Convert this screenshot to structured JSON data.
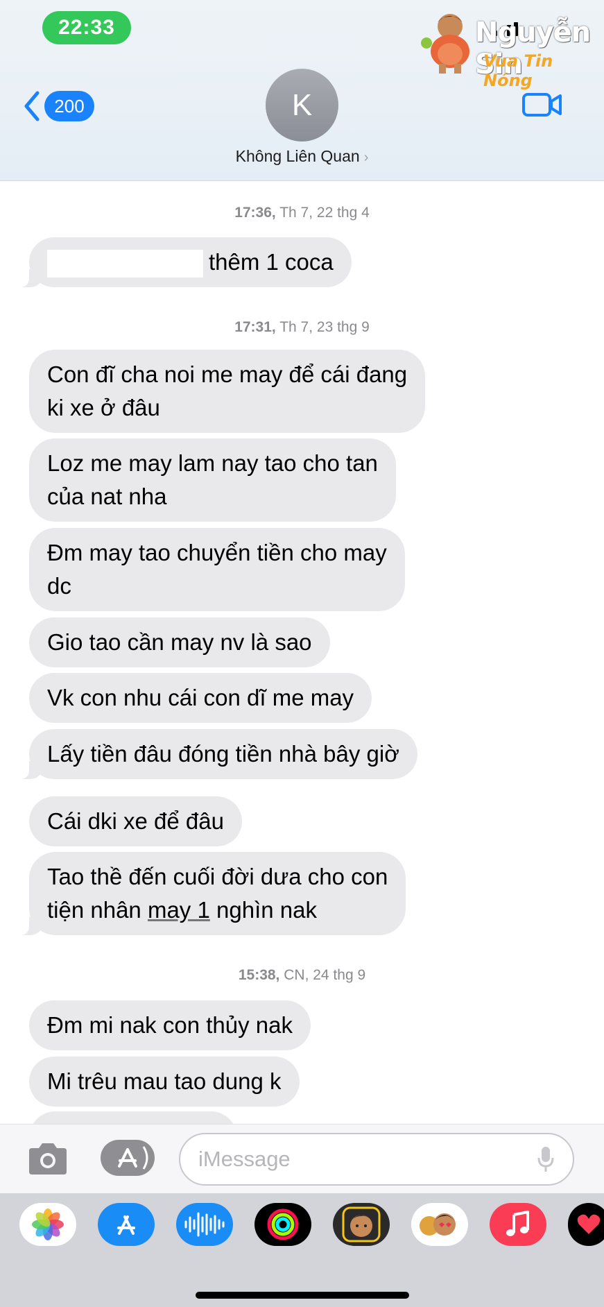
{
  "status_bar": {
    "time": "22:33"
  },
  "watermark": {
    "name": "Nguyễn Sin",
    "tagline": "Vua Tin Nóng"
  },
  "header": {
    "back_count": "200",
    "contact_initial": "K",
    "contact_name": "Không Liên Quan",
    "chevron": "›"
  },
  "messages": {
    "timestamps": [
      {
        "time": "17:36,",
        "date": "Th 7, 22 thg 4"
      },
      {
        "time": "17:31,",
        "date": "Th 7, 23 thg 9"
      },
      {
        "time": "15:38,",
        "date": "CN, 24 thg 9"
      }
    ],
    "bubbles": [
      {
        "text": "thêm 1 coca"
      },
      {
        "line1": "Con đĩ cha noi me may để cái đang",
        "line2": "ki xe ở đâu"
      },
      {
        "line1": "Loz me may lam nay tao cho tan",
        "line2": "của nat nha"
      },
      {
        "line1": "Đm may tao chuyển tiền cho may",
        "line2": "dc"
      },
      {
        "text": "Gio tao cần may nv là sao"
      },
      {
        "text": "Vk con nhu cái con dĩ me may"
      },
      {
        "text": "Lấy tiền đâu đóng tiền nhà bây giờ"
      },
      {
        "text": "Cái dki xe để đâu"
      },
      {
        "line1": "Tao thề đến cuối đời dưa cho con",
        "line2_a": "tiện nhân ",
        "line2_u": "may 1",
        "line2_b": " nghìn nak"
      },
      {
        "text": "Đm mi nak con thủy nak"
      },
      {
        "text": "Mi trêu mau tao dung k"
      }
    ]
  },
  "input_bar": {
    "placeholder": "iMessage",
    "value": "",
    "icons": [
      "camera-icon",
      "app-store-icon",
      "microphone-icon"
    ]
  },
  "app_drawer": {
    "apps": [
      "photos-app-icon",
      "app-store-app-icon",
      "audio-message-app-icon",
      "fitness-app-icon",
      "memoji-app-icon",
      "memoji-stickers-app-icon",
      "music-app-icon",
      "heart-app-icon"
    ]
  },
  "colors": {
    "accent": "#1a82fb",
    "bubble": "#e9e9eb",
    "status_pill": "#34c759",
    "timestamp": "#8a8a8e"
  }
}
